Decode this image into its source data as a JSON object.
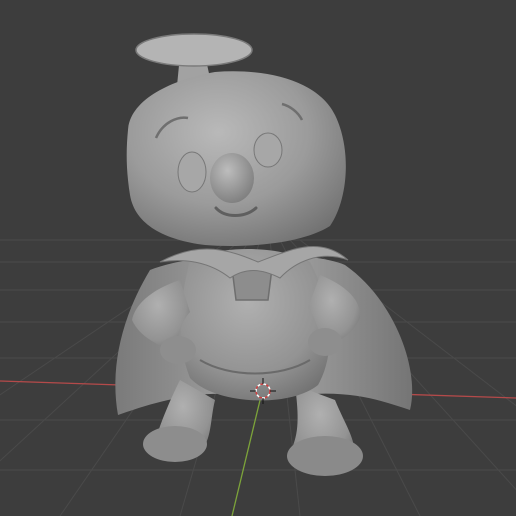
{
  "app": {
    "name": "",
    "view": "3D Viewport"
  },
  "viewport": {
    "shading": "solid",
    "background_color": "#3d3d3d",
    "grid_color": "#4a4a4a",
    "x_axis_color": "#b44a4a",
    "y_axis_color": "#7ca33a",
    "model_color": "#9a9a9a",
    "icons": {
      "cursor": "3d-cursor-icon",
      "origin": "object-origin-icon"
    }
  }
}
